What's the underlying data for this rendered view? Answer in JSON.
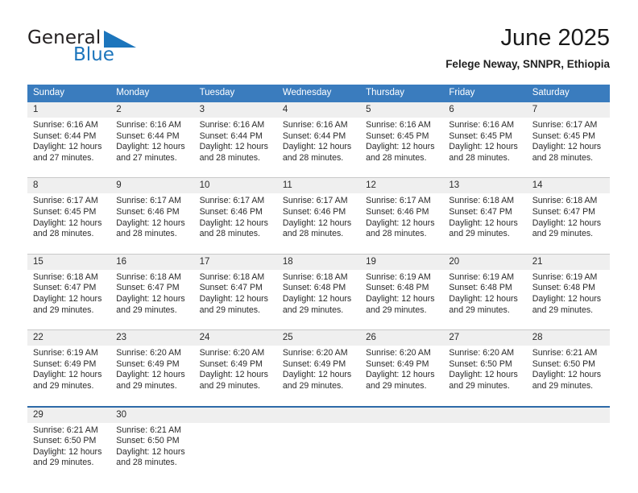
{
  "brand": {
    "name_part1": "General",
    "name_part2": "Blue",
    "accent_color": "#1c75bc"
  },
  "header": {
    "title": "June 2025",
    "subtitle": "Felege Neway, SNNPR, Ethiopia"
  },
  "theme": {
    "header_row_color": "#3a7cbe",
    "daynum_band_color": "#efefef",
    "separator_color": "#c8c8c8",
    "blue_separator_color": "#2d6aa8"
  },
  "weekday_headers": [
    "Sunday",
    "Monday",
    "Tuesday",
    "Wednesday",
    "Thursday",
    "Friday",
    "Saturday"
  ],
  "weeks": [
    {
      "days": [
        {
          "num": "1",
          "sunrise": "Sunrise: 6:16 AM",
          "sunset": "Sunset: 6:44 PM",
          "daylight1": "Daylight: 12 hours",
          "daylight2": "and 27 minutes."
        },
        {
          "num": "2",
          "sunrise": "Sunrise: 6:16 AM",
          "sunset": "Sunset: 6:44 PM",
          "daylight1": "Daylight: 12 hours",
          "daylight2": "and 27 minutes."
        },
        {
          "num": "3",
          "sunrise": "Sunrise: 6:16 AM",
          "sunset": "Sunset: 6:44 PM",
          "daylight1": "Daylight: 12 hours",
          "daylight2": "and 28 minutes."
        },
        {
          "num": "4",
          "sunrise": "Sunrise: 6:16 AM",
          "sunset": "Sunset: 6:44 PM",
          "daylight1": "Daylight: 12 hours",
          "daylight2": "and 28 minutes."
        },
        {
          "num": "5",
          "sunrise": "Sunrise: 6:16 AM",
          "sunset": "Sunset: 6:45 PM",
          "daylight1": "Daylight: 12 hours",
          "daylight2": "and 28 minutes."
        },
        {
          "num": "6",
          "sunrise": "Sunrise: 6:16 AM",
          "sunset": "Sunset: 6:45 PM",
          "daylight1": "Daylight: 12 hours",
          "daylight2": "and 28 minutes."
        },
        {
          "num": "7",
          "sunrise": "Sunrise: 6:17 AM",
          "sunset": "Sunset: 6:45 PM",
          "daylight1": "Daylight: 12 hours",
          "daylight2": "and 28 minutes."
        }
      ]
    },
    {
      "days": [
        {
          "num": "8",
          "sunrise": "Sunrise: 6:17 AM",
          "sunset": "Sunset: 6:45 PM",
          "daylight1": "Daylight: 12 hours",
          "daylight2": "and 28 minutes."
        },
        {
          "num": "9",
          "sunrise": "Sunrise: 6:17 AM",
          "sunset": "Sunset: 6:46 PM",
          "daylight1": "Daylight: 12 hours",
          "daylight2": "and 28 minutes."
        },
        {
          "num": "10",
          "sunrise": "Sunrise: 6:17 AM",
          "sunset": "Sunset: 6:46 PM",
          "daylight1": "Daylight: 12 hours",
          "daylight2": "and 28 minutes."
        },
        {
          "num": "11",
          "sunrise": "Sunrise: 6:17 AM",
          "sunset": "Sunset: 6:46 PM",
          "daylight1": "Daylight: 12 hours",
          "daylight2": "and 28 minutes."
        },
        {
          "num": "12",
          "sunrise": "Sunrise: 6:17 AM",
          "sunset": "Sunset: 6:46 PM",
          "daylight1": "Daylight: 12 hours",
          "daylight2": "and 28 minutes."
        },
        {
          "num": "13",
          "sunrise": "Sunrise: 6:18 AM",
          "sunset": "Sunset: 6:47 PM",
          "daylight1": "Daylight: 12 hours",
          "daylight2": "and 29 minutes."
        },
        {
          "num": "14",
          "sunrise": "Sunrise: 6:18 AM",
          "sunset": "Sunset: 6:47 PM",
          "daylight1": "Daylight: 12 hours",
          "daylight2": "and 29 minutes."
        }
      ]
    },
    {
      "days": [
        {
          "num": "15",
          "sunrise": "Sunrise: 6:18 AM",
          "sunset": "Sunset: 6:47 PM",
          "daylight1": "Daylight: 12 hours",
          "daylight2": "and 29 minutes."
        },
        {
          "num": "16",
          "sunrise": "Sunrise: 6:18 AM",
          "sunset": "Sunset: 6:47 PM",
          "daylight1": "Daylight: 12 hours",
          "daylight2": "and 29 minutes."
        },
        {
          "num": "17",
          "sunrise": "Sunrise: 6:18 AM",
          "sunset": "Sunset: 6:47 PM",
          "daylight1": "Daylight: 12 hours",
          "daylight2": "and 29 minutes."
        },
        {
          "num": "18",
          "sunrise": "Sunrise: 6:18 AM",
          "sunset": "Sunset: 6:48 PM",
          "daylight1": "Daylight: 12 hours",
          "daylight2": "and 29 minutes."
        },
        {
          "num": "19",
          "sunrise": "Sunrise: 6:19 AM",
          "sunset": "Sunset: 6:48 PM",
          "daylight1": "Daylight: 12 hours",
          "daylight2": "and 29 minutes."
        },
        {
          "num": "20",
          "sunrise": "Sunrise: 6:19 AM",
          "sunset": "Sunset: 6:48 PM",
          "daylight1": "Daylight: 12 hours",
          "daylight2": "and 29 minutes."
        },
        {
          "num": "21",
          "sunrise": "Sunrise: 6:19 AM",
          "sunset": "Sunset: 6:48 PM",
          "daylight1": "Daylight: 12 hours",
          "daylight2": "and 29 minutes."
        }
      ]
    },
    {
      "days": [
        {
          "num": "22",
          "sunrise": "Sunrise: 6:19 AM",
          "sunset": "Sunset: 6:49 PM",
          "daylight1": "Daylight: 12 hours",
          "daylight2": "and 29 minutes."
        },
        {
          "num": "23",
          "sunrise": "Sunrise: 6:20 AM",
          "sunset": "Sunset: 6:49 PM",
          "daylight1": "Daylight: 12 hours",
          "daylight2": "and 29 minutes."
        },
        {
          "num": "24",
          "sunrise": "Sunrise: 6:20 AM",
          "sunset": "Sunset: 6:49 PM",
          "daylight1": "Daylight: 12 hours",
          "daylight2": "and 29 minutes."
        },
        {
          "num": "25",
          "sunrise": "Sunrise: 6:20 AM",
          "sunset": "Sunset: 6:49 PM",
          "daylight1": "Daylight: 12 hours",
          "daylight2": "and 29 minutes."
        },
        {
          "num": "26",
          "sunrise": "Sunrise: 6:20 AM",
          "sunset": "Sunset: 6:49 PM",
          "daylight1": "Daylight: 12 hours",
          "daylight2": "and 29 minutes."
        },
        {
          "num": "27",
          "sunrise": "Sunrise: 6:20 AM",
          "sunset": "Sunset: 6:50 PM",
          "daylight1": "Daylight: 12 hours",
          "daylight2": "and 29 minutes."
        },
        {
          "num": "28",
          "sunrise": "Sunrise: 6:21 AM",
          "sunset": "Sunset: 6:50 PM",
          "daylight1": "Daylight: 12 hours",
          "daylight2": "and 29 minutes."
        }
      ]
    },
    {
      "days": [
        {
          "num": "29",
          "sunrise": "Sunrise: 6:21 AM",
          "sunset": "Sunset: 6:50 PM",
          "daylight1": "Daylight: 12 hours",
          "daylight2": "and 29 minutes."
        },
        {
          "num": "30",
          "sunrise": "Sunrise: 6:21 AM",
          "sunset": "Sunset: 6:50 PM",
          "daylight1": "Daylight: 12 hours",
          "daylight2": "and 28 minutes."
        },
        {
          "num": "",
          "sunrise": "",
          "sunset": "",
          "daylight1": "",
          "daylight2": ""
        },
        {
          "num": "",
          "sunrise": "",
          "sunset": "",
          "daylight1": "",
          "daylight2": ""
        },
        {
          "num": "",
          "sunrise": "",
          "sunset": "",
          "daylight1": "",
          "daylight2": ""
        },
        {
          "num": "",
          "sunrise": "",
          "sunset": "",
          "daylight1": "",
          "daylight2": ""
        },
        {
          "num": "",
          "sunrise": "",
          "sunset": "",
          "daylight1": "",
          "daylight2": ""
        }
      ]
    }
  ]
}
